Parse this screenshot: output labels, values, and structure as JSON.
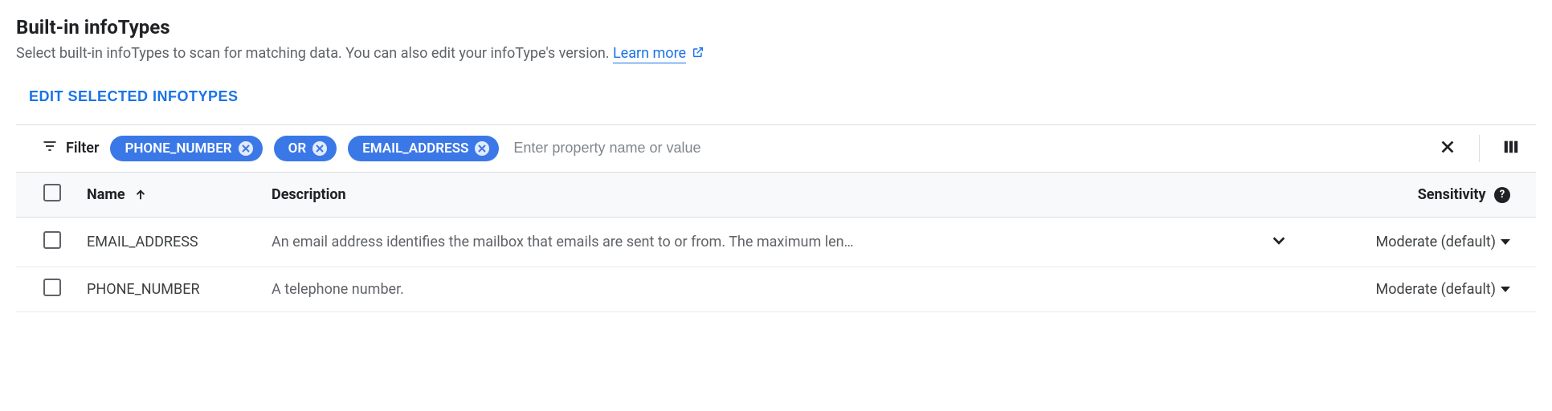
{
  "header": {
    "title": "Built-in infoTypes",
    "subtitle_prefix": "Select built-in infoTypes to scan for matching data. You can also edit your infoType's version. ",
    "learn_more": "Learn more"
  },
  "actions": {
    "edit_selected": "EDIT SELECTED INFOTYPES"
  },
  "filter": {
    "label": "Filter",
    "chips": [
      "PHONE_NUMBER",
      "OR",
      "EMAIL_ADDRESS"
    ],
    "placeholder": "Enter property name or value"
  },
  "table": {
    "columns": {
      "name": "Name",
      "description": "Description",
      "sensitivity": "Sensitivity"
    },
    "rows": [
      {
        "name": "EMAIL_ADDRESS",
        "description": "An email address identifies the mailbox that emails are sent to or from. The maximum len…",
        "expandable": true,
        "sensitivity": "Moderate (default)"
      },
      {
        "name": "PHONE_NUMBER",
        "description": "A telephone number.",
        "expandable": false,
        "sensitivity": "Moderate (default)"
      }
    ]
  }
}
